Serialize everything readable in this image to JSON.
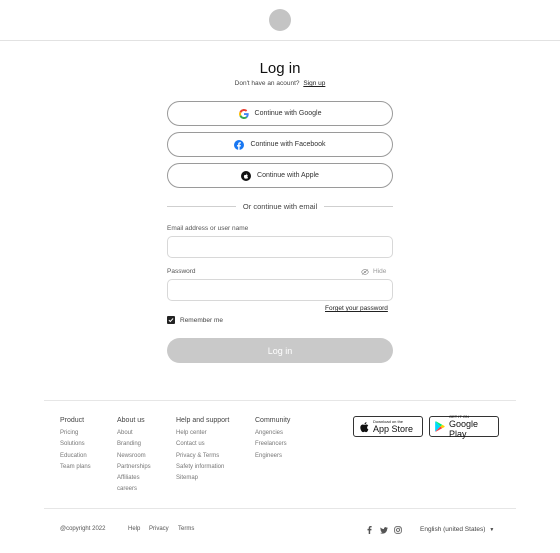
{
  "header": {
    "logo": "logo-circle"
  },
  "login": {
    "title": "Log in",
    "no_account_text": "Don't have an acount?",
    "signup_link": "Sign up",
    "google_label": "Continue with Google",
    "facebook_label": "Continue with Facebook",
    "apple_label": "Continue with Apple",
    "divider_text": "Or continue with email",
    "email_label": "Email address or user name",
    "email_value": "",
    "password_label": "Password",
    "hide_label": "Hide",
    "password_value": "",
    "forgot_link": "Forget your password",
    "remember_label": "Remember me",
    "remember_checked": true,
    "submit_label": "Log in"
  },
  "footer": {
    "columns": [
      {
        "heading": "Product",
        "items": [
          "Pricing",
          "Solutions",
          "Education",
          "Team plans"
        ]
      },
      {
        "heading": "About us",
        "items": [
          "About",
          "Branding",
          "Newsroom",
          "Partnerships",
          "Affiliates",
          "careers"
        ]
      },
      {
        "heading": "Help and support",
        "items": [
          "Help center",
          "Contact us",
          "Privacy & Terms",
          "Safety information",
          "Sitemap"
        ]
      },
      {
        "heading": "Community",
        "items": [
          "Angencies",
          "Freelancers",
          "Engineers"
        ]
      }
    ],
    "app_store": {
      "small": "Download on the",
      "big": "App Store"
    },
    "google_play": {
      "small": "GET IT ON",
      "big": "Google Play"
    },
    "copyright": "@copyright 2022",
    "bottom_links": [
      "Help",
      "Privacy",
      "Terms"
    ],
    "social_icons": [
      "facebook-icon",
      "twitter-icon",
      "instagram-icon"
    ],
    "language": "English (united States)"
  },
  "colors": {
    "accent_disabled": "#c9c9c9",
    "google_blue": "#4285F4",
    "facebook_blue": "#1877F2"
  }
}
